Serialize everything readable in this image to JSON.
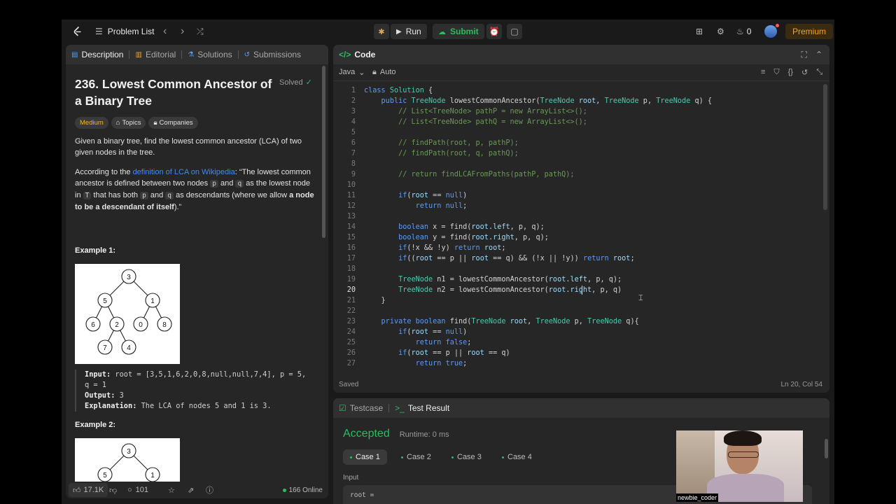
{
  "topbar": {
    "problem_list": "Problem List",
    "run": "Run",
    "submit": "Submit",
    "streak_count": "0",
    "premium": "Premium"
  },
  "left_tabs": [
    "Description",
    "Editorial",
    "Solutions",
    "Submissions"
  ],
  "problem": {
    "title_line1": "236. Lowest Common Ancestor of",
    "title_line2": "a Binary Tree",
    "status": "Solved",
    "difficulty": "Medium",
    "topics": "Topics",
    "companies": "Companies",
    "para1_line1": "Given a binary tree, find the lowest common ancestor (LCA) of two",
    "para1_line2": "given nodes in the tree.",
    "para2_a": "According to the ",
    "para2_link": "definition of LCA on Wikipedia",
    "para2_b": ": “The lowest common",
    "para2_line2_a": "ancestor is defined between two nodes ",
    "para2_p": "p",
    "para2_and": " and ",
    "para2_q": "q",
    "para2_line2_b": " as the lowest node",
    "para2_line3_a": "in ",
    "para2_T": "T",
    "para2_line3_b": " that has both ",
    "para2_line3_c": " as descendants (where we allow ",
    "para2_bold1": "a node",
    "para2_bold2": "to be a descendant of itself",
    "para2_end": ").”",
    "example1_label": "Example 1:",
    "input_label": "Input:",
    "input_value": " root = [3,5,1,6,2,0,8,null,null,7,4], p = 5,",
    "input_value2": "q = 1",
    "output_label": "Output:",
    "output_value": " 3",
    "explanation_label": "Explanation:",
    "explanation_value": " The LCA of nodes 5 and 1 is 3.",
    "example2_label": "Example 2:"
  },
  "tree1": [
    "3",
    "5",
    "1",
    "6",
    "2",
    "0",
    "8",
    "7",
    "4"
  ],
  "tree2": [
    "3",
    "5",
    "1"
  ],
  "left_footer": {
    "likes": "17.1K",
    "comments": "101",
    "online": "166 Online"
  },
  "code_panel": {
    "title": "Code",
    "language": "Java",
    "mode": "Auto",
    "saved": "Saved",
    "cursor": "Ln 20, Col 54"
  },
  "code_lines": [
    "class Solution {",
    "    public TreeNode lowestCommonAncestor(TreeNode root, TreeNode p, TreeNode q) {",
    "        // List<TreeNode> pathP = new ArrayList<>();",
    "        // List<TreeNode> pathQ = new ArrayList<>();",
    "",
    "        // findPath(root, p, pathP);",
    "        // findPath(root, q, pathQ);",
    "",
    "        // return findLCAFromPaths(pathP, pathQ);",
    "",
    "        if(root == null)",
    "            return null;",
    "",
    "        boolean x = find(root.left, p, q);",
    "        boolean y = find(root.right, p, q);",
    "        if(!x && !y) return root;",
    "        if((root == p || root == q) && (!x || !y)) return root;",
    "",
    "        TreeNode n1 = lowestCommonAncestor(root.left, p, q);",
    "        TreeNode n2 = lowestCommonAncestor(root.right, p, q)",
    "    }",
    "",
    "    private boolean find(TreeNode root, TreeNode p, TreeNode q){",
    "        if(root == null)",
    "            return false;",
    "        if(root == p || root == q)",
    "            return true;"
  ],
  "test_panel": {
    "testcase_tab": "Testcase",
    "result_tab": "Test Result",
    "verdict": "Accepted",
    "runtime": "Runtime: 0 ms",
    "cases": [
      "Case 1",
      "Case 2",
      "Case 3",
      "Case 4"
    ],
    "input_label": "Input",
    "input_field": "root ="
  },
  "webcam": {
    "username": "newbie_coder"
  },
  "colors": {
    "accent_green": "#2cbb5d",
    "medium_orange": "#ffb800",
    "link_blue": "#3e8bf6",
    "premium": "#ffa116"
  }
}
